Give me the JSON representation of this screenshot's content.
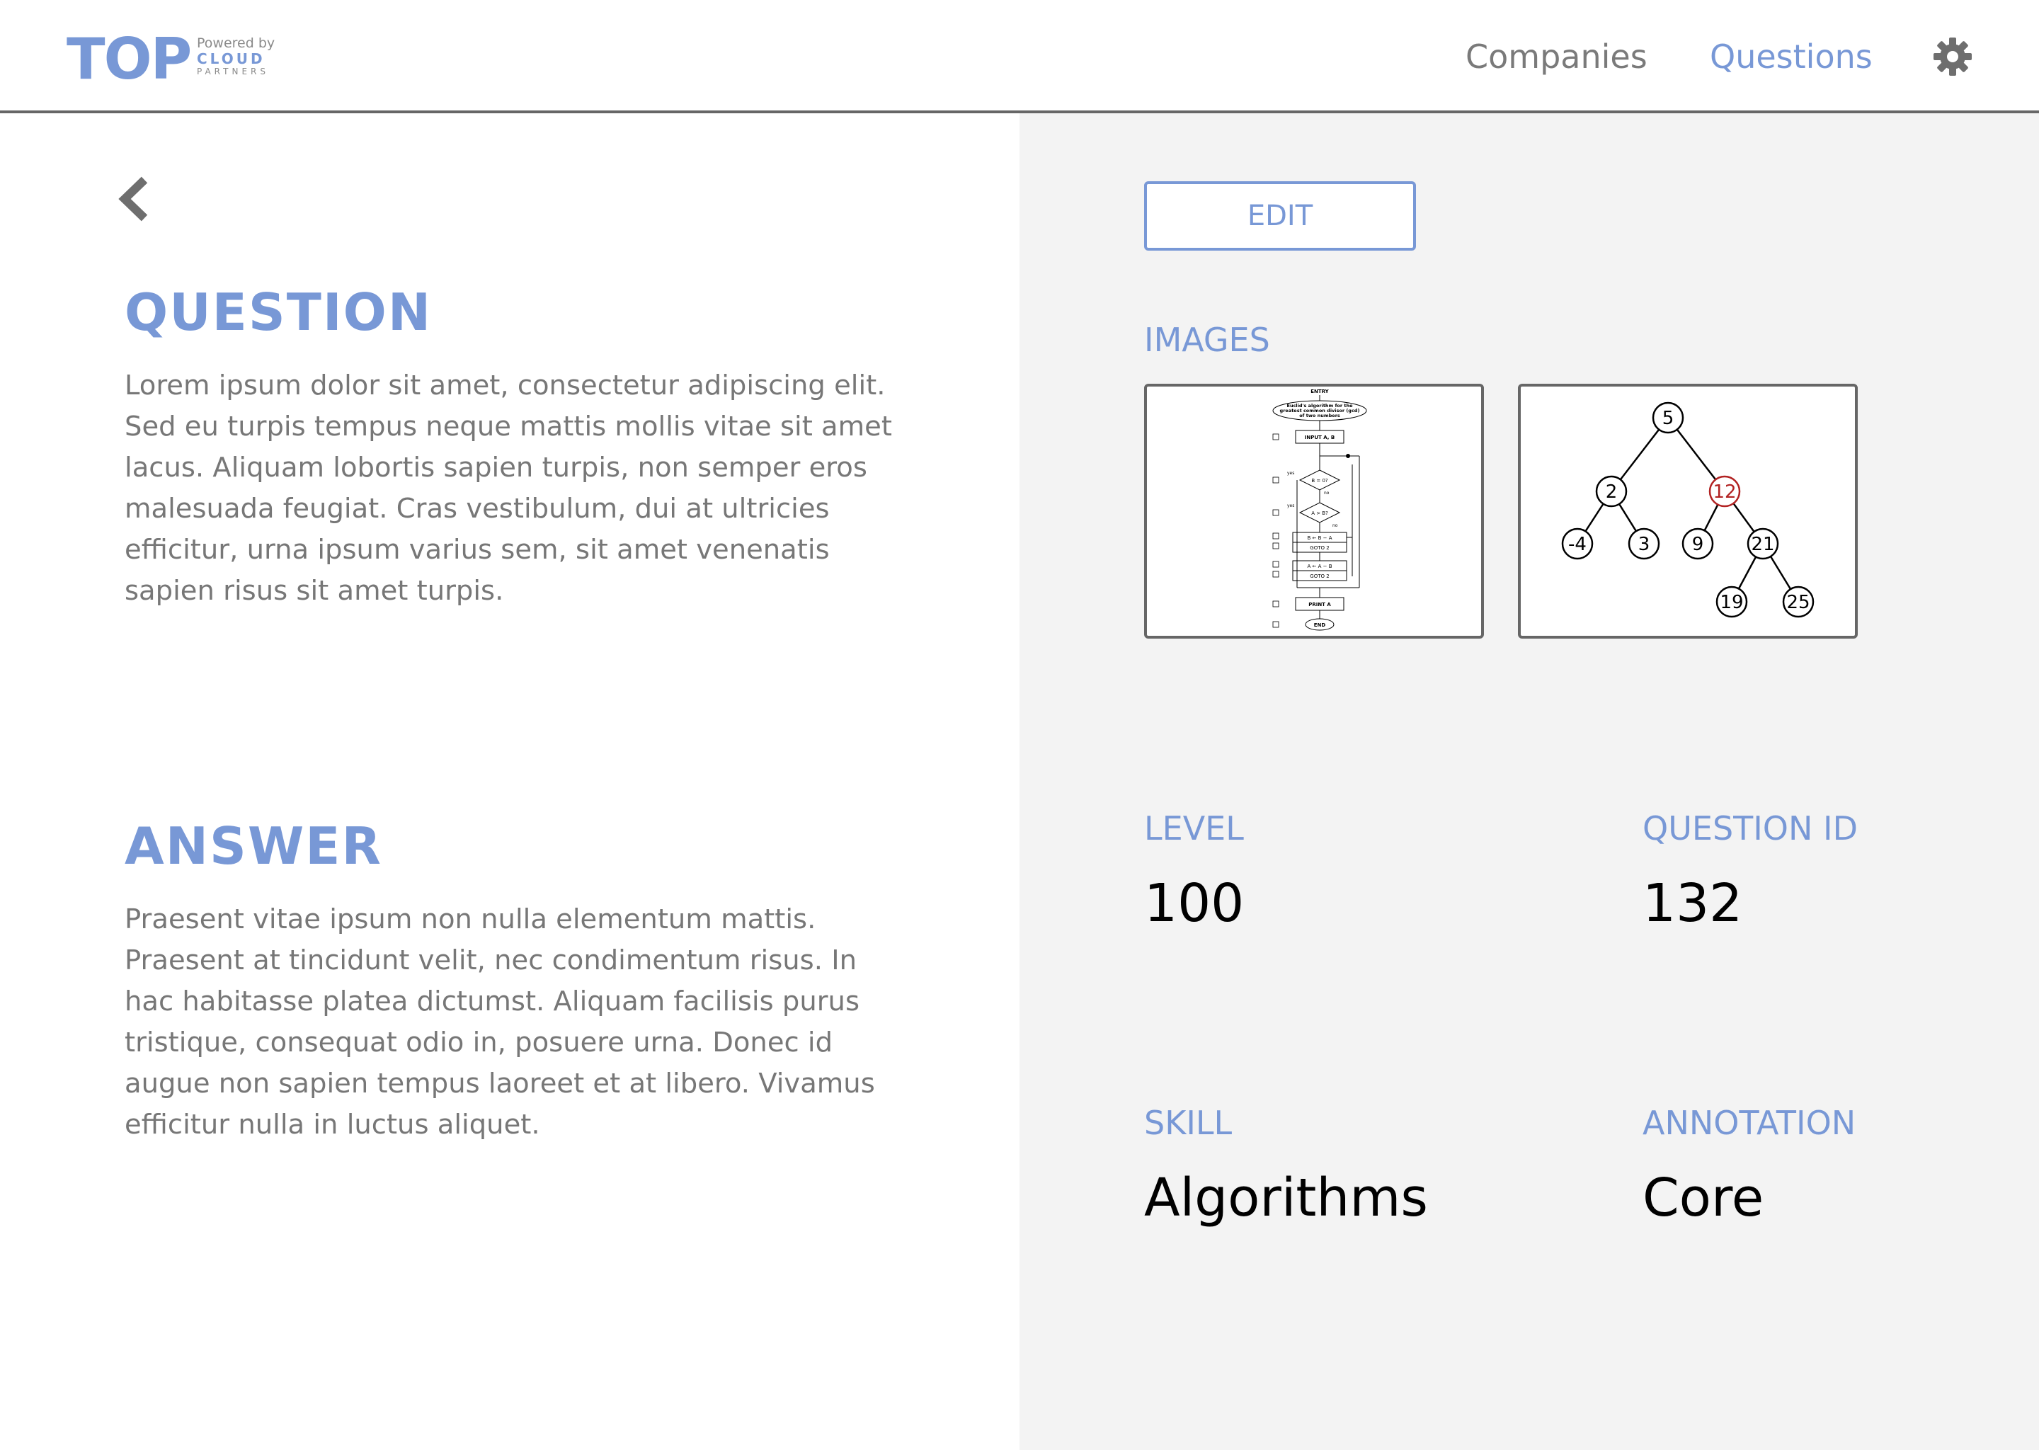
{
  "header": {
    "logo": {
      "main": "TOP",
      "powered_by": "Powered by",
      "brand": "CLOUD",
      "brand_sub": "PARTNERS"
    },
    "nav": {
      "companies": "Companies",
      "questions": "Questions"
    },
    "icons": {
      "settings": "gear-icon",
      "back": "chevron-left-icon"
    }
  },
  "question": {
    "heading": "QUESTION",
    "body": "Lorem ipsum dolor sit amet, consectetur adipiscing elit. Sed eu turpis tempus neque mattis mollis vitae sit amet lacus. Aliquam lobortis sapien turpis, non semper eros malesuada feugiat. Cras vestibulum, dui at ultricies efficitur, urna ipsum varius sem, sit amet venenatis sapien risus sit amet turpis."
  },
  "answer": {
    "heading": "ANSWER",
    "body": "Praesent vitae ipsum non nulla elementum mattis. Praesent at tincidunt velit, nec condimentum risus. In hac habitasse platea dictumst. Aliquam facilisis purus tristique, consequat odio in, posuere urna. Donec id augue non sapien tempus laoreet et at libero. Vivamus efficitur nulla in luctus aliquet."
  },
  "details": {
    "edit_label": "EDIT",
    "images_label": "IMAGES",
    "flowchart": {
      "entry": "ENTRY",
      "title1": "Euclid's algorithm for the",
      "title2": "greatest common divisor (gcd)",
      "title3": "of two numbers",
      "input": "INPUT A, B",
      "cond1": "B = 0?",
      "cond2": "A > B?",
      "step1": "B ← B − A",
      "goto": "GOTO 2",
      "step2": "A ← A − B",
      "print": "PRINT A",
      "end": "END",
      "yes": "yes",
      "no": "no"
    },
    "tree_nodes": [
      "5",
      "2",
      "12",
      "-4",
      "3",
      "9",
      "21",
      "19",
      "25"
    ],
    "level_label": "LEVEL",
    "level_value": "100",
    "question_id_label": "QUESTION ID",
    "question_id_value": "132",
    "skill_label": "SKILL",
    "skill_value": "Algorithms",
    "annotation_label": "ANNOTATION",
    "annotation_value": "Core"
  },
  "colors": {
    "accent": "#7898d6",
    "muted_text": "#777777",
    "panel_bg": "#f3f3f3",
    "highlight_node": "#b22222"
  }
}
